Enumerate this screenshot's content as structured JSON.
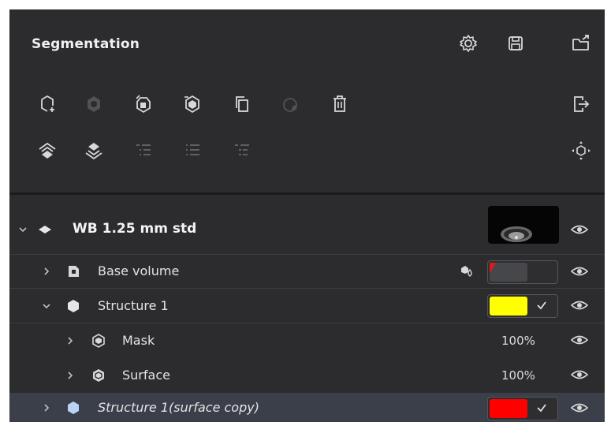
{
  "panel": {
    "title": "Segmentation"
  },
  "header_icons": [
    "settings-gear-icon",
    "save-disk-icon",
    "export-folder-icon",
    "add-structure-icon",
    "structure-from-volume-icon",
    "convert-surface-icon",
    "convert-mask-icon",
    "duplicate-icon",
    "merge-icon",
    "delete-icon",
    "exit-icon",
    "layers-up-icon",
    "layers-down-icon",
    "list-indent-icon",
    "list-expand-icon",
    "list-collapse-icon",
    "center-view-icon"
  ],
  "tree": {
    "dataset": {
      "label": "WB 1.25 mm std",
      "expanded": true
    },
    "base_volume": {
      "label": "Base volume",
      "expanded": false
    },
    "structure1": {
      "label": "Structure 1",
      "expanded": true,
      "color": "#ffff00"
    },
    "mask": {
      "label": "Mask",
      "opacity": "100%"
    },
    "surface": {
      "label": "Surface",
      "opacity": "100%"
    },
    "structure_copy": {
      "label": "Structure 1(surface copy)",
      "color": "#ff0000",
      "selected": true
    }
  },
  "colors": {
    "panel_bg": "#2c2c2f",
    "selected_row_bg": "#3a3f4a",
    "structure1_color": "#ffff00",
    "surface_copy_color": "#ff0000"
  }
}
